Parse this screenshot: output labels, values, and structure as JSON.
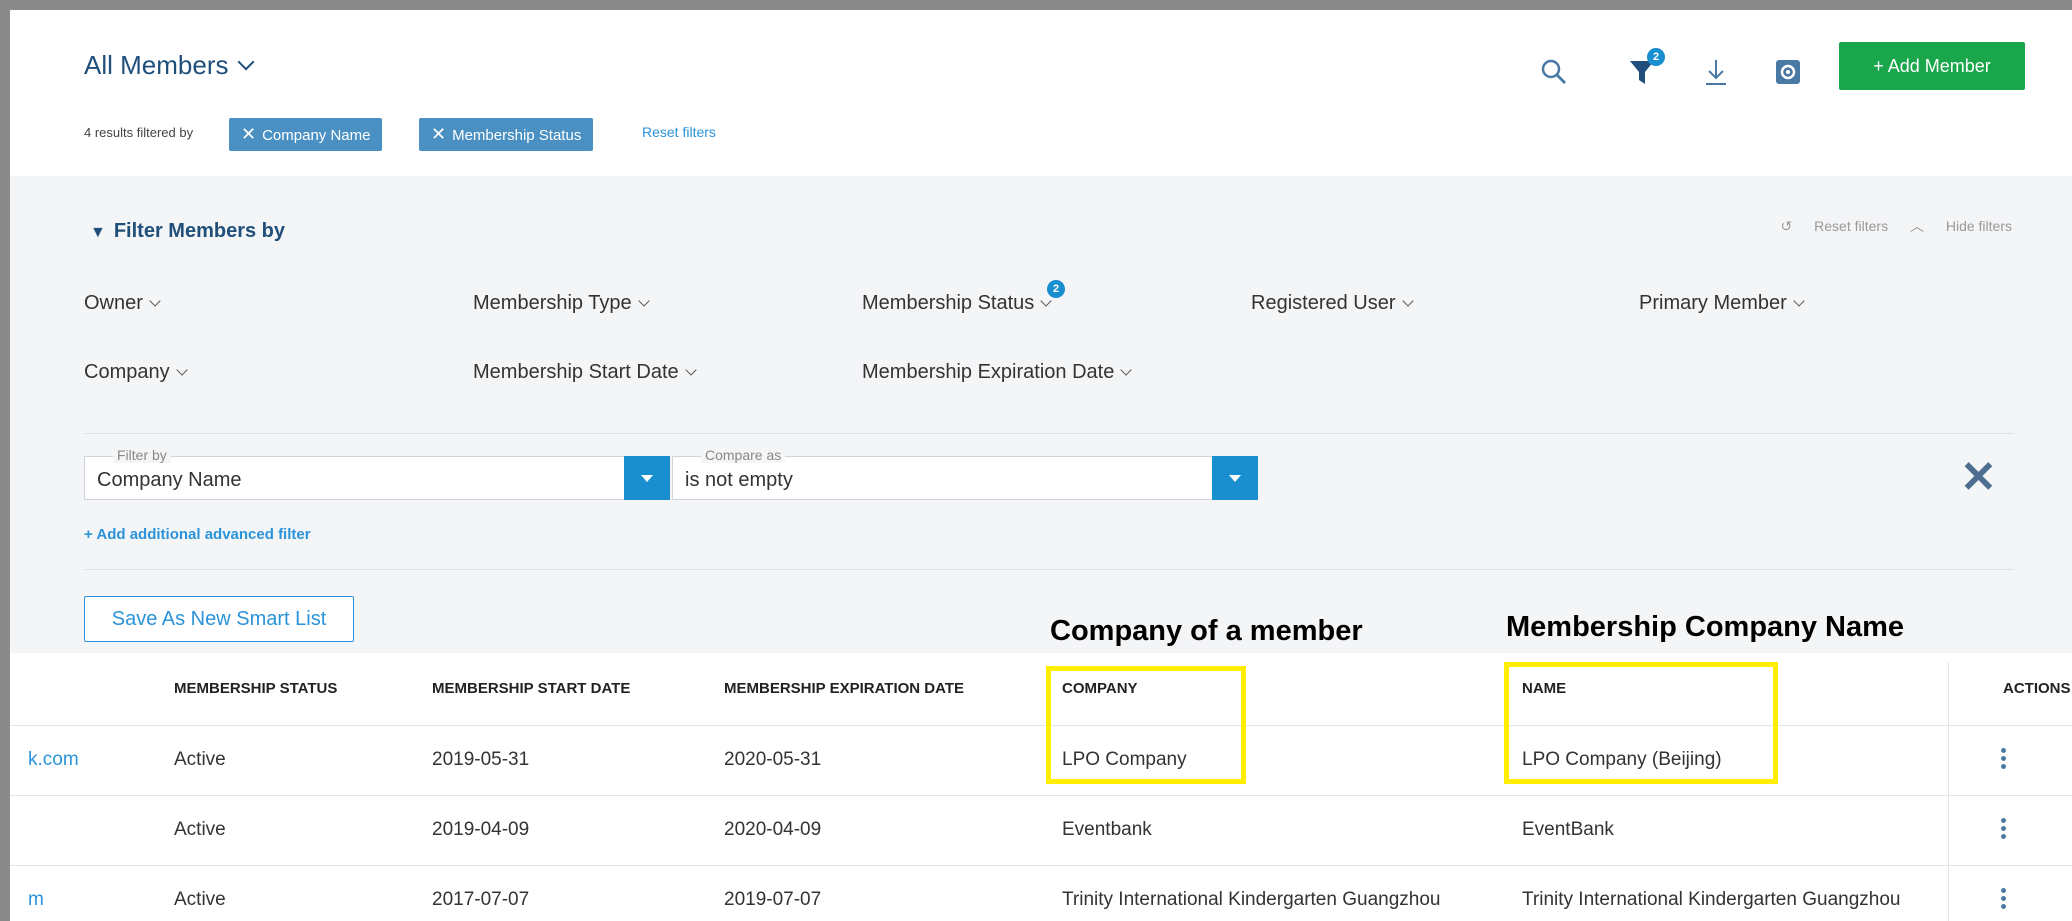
{
  "header": {
    "title": "All Members",
    "results_text": "4 results filtered by",
    "chips": [
      "Company Name",
      "Membership Status"
    ],
    "reset_label": "Reset filters",
    "filter_badge": "2",
    "add_button": "+ Add Member",
    "icons": [
      "search-icon",
      "filter-icon",
      "download-icon",
      "settings-icon"
    ]
  },
  "filter_panel": {
    "title": "Filter Members by",
    "reset_label": "Reset filters",
    "hide_label": "Hide filters",
    "fields": [
      "Owner",
      "Membership Type",
      "Membership Status",
      "Registered User",
      "Primary Member",
      "Company",
      "Membership Start Date",
      "Membership Expiration Date"
    ],
    "status_badge": "2",
    "filter_by": {
      "legend": "Filter by",
      "value": "Company Name"
    },
    "compare_as": {
      "legend": "Compare as",
      "value": "is not empty"
    },
    "add_advanced": "+ Add additional advanced filter",
    "save_button": "Save As New Smart List"
  },
  "annotations": {
    "company_label": "Company of a member",
    "name_label": "Membership Company Name",
    "highlight_color": "#ffee00"
  },
  "table": {
    "columns": [
      "MEMBERSHIP STATUS",
      "MEMBERSHIP START DATE",
      "MEMBERSHIP EXPIRATION DATE",
      "COMPANY",
      "NAME",
      "ACTIONS"
    ],
    "rows": [
      {
        "email": "k.com",
        "status": "Active",
        "start": "2019-05-31",
        "expiration": "2020-05-31",
        "company": "LPO Company",
        "name": "LPO Company (Beijing)"
      },
      {
        "email": "",
        "status": "Active",
        "start": "2019-04-09",
        "expiration": "2020-04-09",
        "company": "Eventbank",
        "name": "EventBank"
      },
      {
        "email": "m",
        "status": "Active",
        "start": "2017-07-07",
        "expiration": "2019-07-07",
        "company": "Trinity International Kindergarten Guangzhou",
        "name": "Trinity International Kindergarten Guangzhou"
      }
    ]
  },
  "colors": {
    "accent": "#1a8fd0",
    "add_button": "#1aa64a",
    "chip": "#4a90c2",
    "title": "#1f4f7a"
  }
}
